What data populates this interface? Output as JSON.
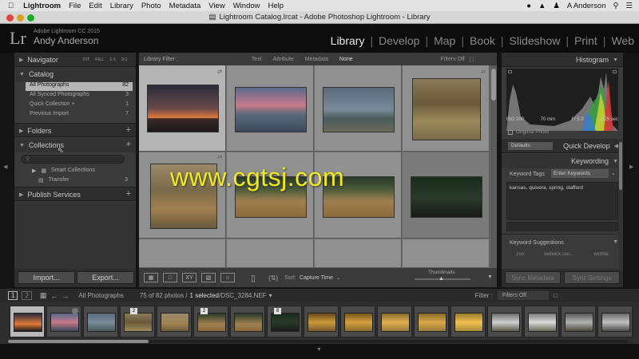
{
  "menubar": {
    "app": "Lightroom",
    "items": [
      "File",
      "Edit",
      "Library",
      "Photo",
      "Metadata",
      "View",
      "Window",
      "Help"
    ],
    "user": "A Anderson"
  },
  "window": {
    "title": "Lightroom Catalog.lrcat - Adobe Photoshop Lightroom - Library"
  },
  "identity": {
    "logo": "Lr",
    "product": "Adobe Lightroom CC 2015",
    "user": "Andy Anderson"
  },
  "modules": [
    "Library",
    "Develop",
    "Map",
    "Book",
    "Slideshow",
    "Print",
    "Web"
  ],
  "left": {
    "navigator": {
      "title": "Navigator",
      "zoom": [
        "FIT",
        "FILL",
        "1:1",
        "3:1"
      ]
    },
    "catalog": {
      "title": "Catalog",
      "items": [
        {
          "label": "All Photographs",
          "count": "82"
        },
        {
          "label": "All Synced Photographs",
          "count": "3"
        },
        {
          "label": "Quick Collection +",
          "count": "1"
        },
        {
          "label": "Previous Import",
          "count": "7"
        }
      ]
    },
    "folders": {
      "title": "Folders"
    },
    "collections": {
      "title": "Collections",
      "items": [
        {
          "label": "Smart Collections",
          "count": ""
        },
        {
          "label": "Transfer",
          "count": "3"
        }
      ]
    },
    "publish": {
      "title": "Publish Services"
    },
    "import_label": "Import...",
    "export_label": "Export..."
  },
  "center": {
    "filter": {
      "label": "Library Filter :",
      "tabs": [
        "Text",
        "Attribute",
        "Metadata",
        "None"
      ],
      "off": "Filters Off"
    },
    "toolbar": {
      "sort_label": "Sort:",
      "sort_value": "Capture Time",
      "thumbs_label": "Thumbnails"
    }
  },
  "right": {
    "histogram": {
      "title": "Histogram",
      "iso": "ISO 200",
      "focal": "70 mm",
      "aperture": "f / 5.0",
      "shutter": "1/25 sec",
      "original": "Original Photo"
    },
    "quick_develop": {
      "preset": "Defaults",
      "title": "Quick Develop"
    },
    "keywording": {
      "title": "Keywording",
      "tags_label": "Keyword Tags",
      "tags_mode": "Enter Keywords",
      "tags": "kansas, quivera, spring, stafford",
      "suggestions_label": "Keyword Suggestions",
      "suggestions": [
        "zoo",
        "sedwick.cou...",
        "wichita"
      ]
    },
    "sync_metadata": "Sync Metadata",
    "sync_settings": "Sync Settings"
  },
  "filmstrip": {
    "pages": [
      "1",
      "2"
    ],
    "source": "All Photographs",
    "status": "75 of 82 photos /",
    "selected": "1 selected",
    "filename": "/DSC_3284.NEF",
    "filter_label": "Filter :",
    "filter_value": "Filters Off",
    "badges": [
      "2",
      "2",
      "8"
    ]
  },
  "watermark": "www.cgtsj.com",
  "colors": {
    "accent": "#f2ea1a",
    "panel": "#3a3a3a",
    "grid": "#6a6a6a"
  }
}
